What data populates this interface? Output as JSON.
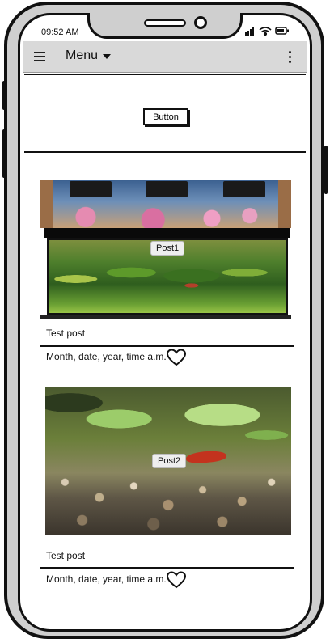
{
  "status_bar": {
    "time": "09:52 AM",
    "icons": [
      "signal-icon",
      "wifi-icon",
      "battery-icon"
    ]
  },
  "app_bar": {
    "title": "Menu",
    "icons": [
      "hamburger-icon",
      "chevron-down-icon",
      "kebab-icon"
    ]
  },
  "panel": {
    "button_label": "Button"
  },
  "posts": [
    {
      "image_label": "Post1",
      "title": "Test post",
      "meta": "Month, date, year, time a.m.",
      "icon": "heart-icon"
    },
    {
      "image_label": "Post2",
      "title": "Test post",
      "meta": "Month, date, year, time a.m.",
      "icon": "heart-icon"
    }
  ],
  "colors": {
    "phone_frame": "#cfcfcf",
    "app_bar": "#d9d9d9",
    "outline": "#111111"
  }
}
